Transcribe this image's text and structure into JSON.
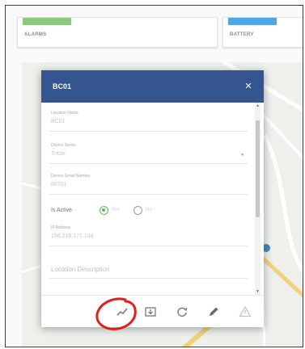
{
  "cards": {
    "alarms": {
      "label": "ALARMS",
      "color": "#8cc97a"
    },
    "battery": {
      "label": "BATTERY",
      "color": "#4da6e8"
    }
  },
  "modal": {
    "title": "BC01",
    "close_symbol": "×",
    "header_color": "#345590",
    "fields": {
      "location_name": {
        "label": "Location Name",
        "value": "BC01"
      },
      "device_series": {
        "label": "Device Series",
        "value": "Triton"
      },
      "device_serial": {
        "label": "Device Serial Number",
        "value": "80701"
      },
      "ip_address": {
        "label": "IP Address",
        "value": "166.218.172.144"
      },
      "location_description": {
        "placeholder": "Location Description"
      }
    },
    "is_active": {
      "label": "Is Active",
      "yes": "Yes",
      "no": "No",
      "selected": "Yes",
      "accent": "#5cb85c"
    },
    "toolbar": {
      "icons": [
        "chart-icon",
        "download-icon",
        "refresh-icon",
        "edit-icon",
        "warning-icon"
      ]
    }
  },
  "annotation": {
    "color": "#e0201c"
  }
}
